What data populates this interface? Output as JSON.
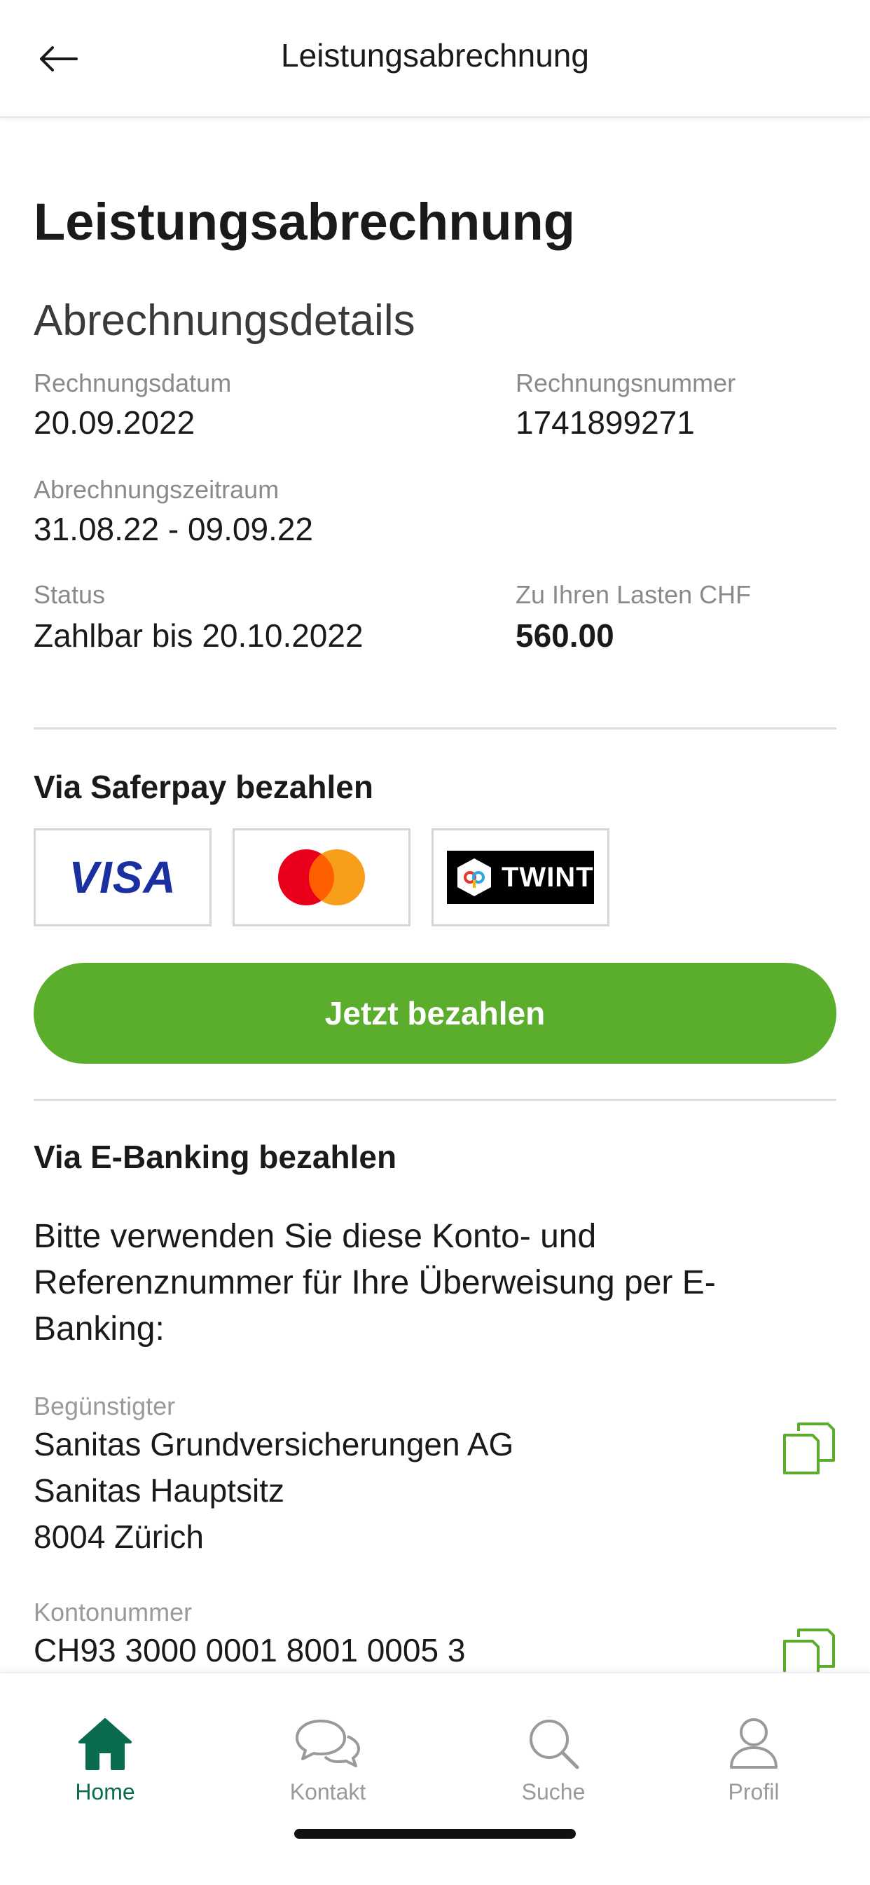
{
  "header": {
    "title": "Leistungsabrechnung"
  },
  "page": {
    "title": "Leistungsabrechnung",
    "subtitle": "Abrechnungsdetails"
  },
  "details": {
    "invoice_date_label": "Rechnungsdatum",
    "invoice_date_value": "20.09.2022",
    "invoice_number_label": "Rechnungsnummer",
    "invoice_number_value": "1741899271",
    "period_label": "Abrechnungszeitraum",
    "period_value": "31.08.22 - 09.09.22",
    "status_label": "Status",
    "status_value": "Zahlbar bis 20.10.2022",
    "amount_label": "Zu Ihren Lasten CHF",
    "amount_value": "560.00"
  },
  "saferpay": {
    "heading": "Via Saferpay bezahlen",
    "methods": [
      "VISA",
      "Mastercard",
      "TWINT"
    ],
    "visa_label": "VISA",
    "twint_label": "TWINT",
    "pay_button": "Jetzt bezahlen"
  },
  "ebanking": {
    "heading": "Via E-Banking bezahlen",
    "instructions": "Bitte verwenden Sie diese Konto- und Referenznummer für Ihre Überweisung per E-Banking:",
    "beneficiary_label": "Begünstigter",
    "beneficiary_line1": "Sanitas Grundversicherungen AG",
    "beneficiary_line2": "Sanitas Hauptsitz",
    "beneficiary_line3": "8004 Zürich",
    "account_label": "Kontonummer",
    "account_value": "CH93 3000 0001 8001 0005 3"
  },
  "nav": {
    "home": "Home",
    "contact": "Kontakt",
    "search": "Suche",
    "profile": "Profil"
  },
  "colors": {
    "accent_green": "#5aae2c",
    "nav_active": "#0a6b4f",
    "visa_blue": "#1a2fa0",
    "mastercard_red": "#eb001b",
    "mastercard_orange": "#f79e1b"
  },
  "icons": [
    "back-arrow-icon",
    "copy-icon",
    "home-icon",
    "chat-icon",
    "search-icon",
    "user-icon"
  ]
}
